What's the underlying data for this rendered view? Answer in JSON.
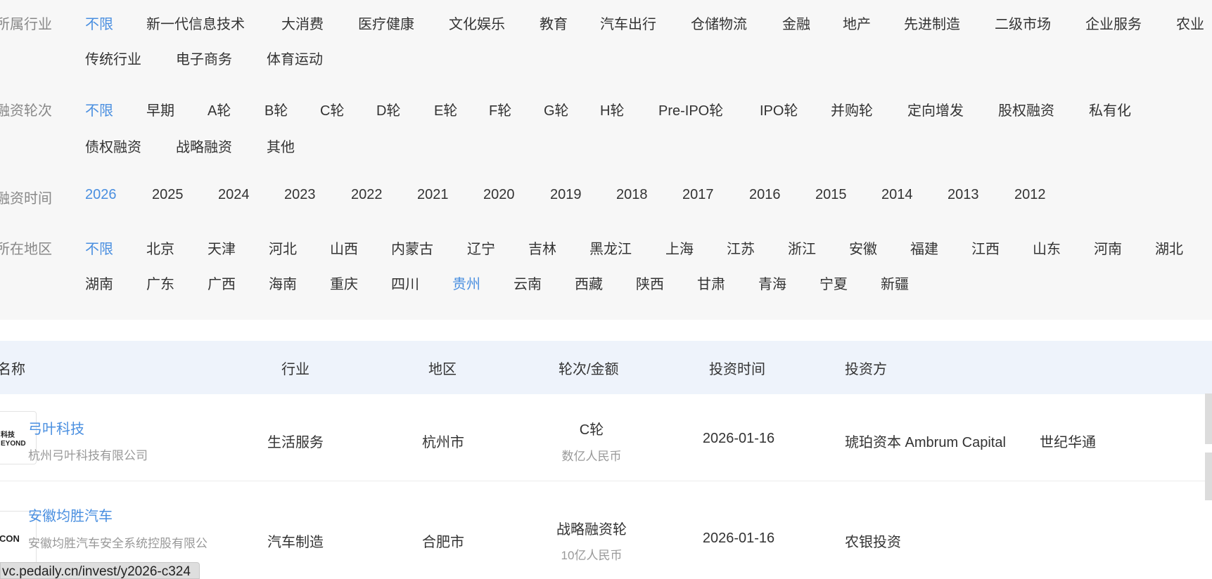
{
  "filters": {
    "industry": {
      "label": "所属行业",
      "options": [
        "不限",
        "新一代信息技术",
        "大消费",
        "医疗健康",
        "文化娱乐",
        "教育",
        "汽车出行",
        "仓储物流",
        "金融",
        "地产",
        "先进制造",
        "二级市场",
        "企业服务",
        "农业",
        "传统行业",
        "电子商务",
        "体育运动"
      ],
      "active": "不限"
    },
    "round": {
      "label": "融资轮次",
      "options": [
        "不限",
        "早期",
        "A轮",
        "B轮",
        "C轮",
        "D轮",
        "E轮",
        "F轮",
        "G轮",
        "H轮",
        "Pre-IPO轮",
        "IPO轮",
        "并购轮",
        "定向增发",
        "股权融资",
        "私有化",
        "债权融资",
        "战略融资",
        "其他"
      ],
      "active": "不限"
    },
    "time": {
      "label": "融资时间",
      "options": [
        "2026",
        "2025",
        "2024",
        "2023",
        "2022",
        "2021",
        "2020",
        "2019",
        "2018",
        "2017",
        "2016",
        "2015",
        "2014",
        "2013",
        "2012"
      ],
      "active": "2026"
    },
    "region": {
      "label": "所在地区",
      "options": [
        "不限",
        "北京",
        "天津",
        "河北",
        "山西",
        "内蒙古",
        "辽宁",
        "吉林",
        "黑龙江",
        "上海",
        "江苏",
        "浙江",
        "安徽",
        "福建",
        "江西",
        "山东",
        "河南",
        "湖北",
        "湖南",
        "广东",
        "广西",
        "海南",
        "重庆",
        "四川",
        "贵州",
        "云南",
        "西藏",
        "陕西",
        "甘肃",
        "青海",
        "宁夏",
        "新疆"
      ],
      "active": [
        "不限",
        "贵州"
      ]
    }
  },
  "table": {
    "headers": {
      "name": "名称",
      "industry": "行业",
      "region": "地区",
      "round": "轮次/金额",
      "date": "投资时间",
      "investors": "投资方"
    },
    "rows": [
      {
        "logo_text": "科技\nEYOND",
        "name": "弓叶科技",
        "full_name": "杭州弓叶科技有限公司",
        "industry": "生活服务",
        "region": "杭州市",
        "round": "C轮",
        "amount": "数亿人民币",
        "date": "2026-01-16",
        "investors": [
          "琥珀资本 Ambrum Capital",
          "世纪华通"
        ]
      },
      {
        "logo_text": "CON",
        "name": "安徽均胜汽车",
        "full_name": "安徽均胜汽车安全系统控股有限公",
        "industry": "汽车制造",
        "region": "合肥市",
        "round": "战略融资轮",
        "amount": "10亿人民币",
        "date": "2026-01-16",
        "investors": [
          "农银投资"
        ]
      }
    ]
  },
  "status_bar": {
    "url": "vc.pedaily.cn/invest/y2026-c324"
  },
  "colors": {
    "accent": "#4a8fe0",
    "panel_bg": "#f7f7f7",
    "header_bg": "#eef3fb",
    "muted": "#999999"
  }
}
